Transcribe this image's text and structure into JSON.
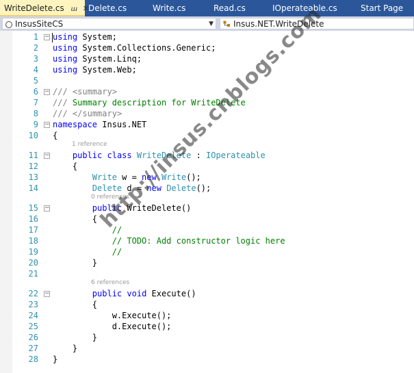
{
  "tabs": [
    {
      "label": "WriteDelete.cs",
      "active": true
    },
    {
      "label": "Delete.cs",
      "active": false
    },
    {
      "label": "Write.cs",
      "active": false
    },
    {
      "label": "Read.cs",
      "active": false
    },
    {
      "label": "IOperateable.cs",
      "active": false
    },
    {
      "label": "Start Page",
      "active": false
    }
  ],
  "nav": {
    "project": "InsusSiteCS",
    "member": "Insus.NET.WriteDelete"
  },
  "code": {
    "line_numbers": [
      "1",
      "2",
      "3",
      "4",
      "5",
      "6",
      "7",
      "8",
      "9",
      "10",
      "11",
      "12",
      "13",
      "14",
      "15",
      "16",
      "17",
      "18",
      "19",
      "20",
      "21",
      "22",
      "23",
      "24",
      "25",
      "26",
      "27",
      "28"
    ],
    "lines": [
      [
        {
          "s": "using",
          "c": "k"
        },
        {
          "s": " System;",
          "c": ""
        }
      ],
      [
        {
          "s": "using",
          "c": "k"
        },
        {
          "s": " System.Collections.Generic;",
          "c": ""
        }
      ],
      [
        {
          "s": "using",
          "c": "k"
        },
        {
          "s": " System.Linq;",
          "c": ""
        }
      ],
      [
        {
          "s": "using",
          "c": "k"
        },
        {
          "s": " System.Web;",
          "c": ""
        }
      ],
      [],
      [
        {
          "s": "///",
          "c": "g"
        },
        {
          "s": " ",
          "c": ""
        },
        {
          "s": "<summary>",
          "c": "g"
        }
      ],
      [
        {
          "s": "///",
          "c": "g"
        },
        {
          "s": " Summary description for WriteDelete",
          "c": "c"
        }
      ],
      [
        {
          "s": "///",
          "c": "g"
        },
        {
          "s": " ",
          "c": ""
        },
        {
          "s": "</summary>",
          "c": "g"
        }
      ],
      [
        {
          "s": "namespace",
          "c": "k"
        },
        {
          "s": " Insus.NET",
          "c": ""
        }
      ],
      [
        {
          "s": "{",
          "c": ""
        }
      ],
      [
        {
          "s": "    ",
          "c": ""
        },
        {
          "s": "public",
          "c": "k"
        },
        {
          "s": " ",
          "c": ""
        },
        {
          "s": "class",
          "c": "k"
        },
        {
          "s": " ",
          "c": ""
        },
        {
          "s": "WriteDelete",
          "c": "t"
        },
        {
          "s": " : ",
          "c": ""
        },
        {
          "s": "IOperateable",
          "c": "t"
        }
      ],
      [
        {
          "s": "    {",
          "c": ""
        }
      ],
      [
        {
          "s": "        ",
          "c": ""
        },
        {
          "s": "Write",
          "c": "t"
        },
        {
          "s": " w = ",
          "c": ""
        },
        {
          "s": "new",
          "c": "k"
        },
        {
          "s": " ",
          "c": ""
        },
        {
          "s": "Write",
          "c": "t"
        },
        {
          "s": "();",
          "c": ""
        }
      ],
      [
        {
          "s": "        ",
          "c": ""
        },
        {
          "s": "Delete",
          "c": "t"
        },
        {
          "s": " d = ",
          "c": ""
        },
        {
          "s": "new",
          "c": "k"
        },
        {
          "s": " ",
          "c": ""
        },
        {
          "s": "Delete",
          "c": "t"
        },
        {
          "s": "();",
          "c": ""
        }
      ],
      [
        {
          "s": "        ",
          "c": ""
        },
        {
          "s": "public",
          "c": "k"
        },
        {
          "s": " WriteDelete()",
          "c": ""
        }
      ],
      [
        {
          "s": "        {",
          "c": ""
        }
      ],
      [
        {
          "s": "            ",
          "c": ""
        },
        {
          "s": "//",
          "c": "c"
        }
      ],
      [
        {
          "s": "            ",
          "c": ""
        },
        {
          "s": "// TODO: Add constructor logic here",
          "c": "c"
        }
      ],
      [
        {
          "s": "            ",
          "c": ""
        },
        {
          "s": "//",
          "c": "c"
        }
      ],
      [
        {
          "s": "        }",
          "c": ""
        }
      ],
      [],
      [
        {
          "s": "        ",
          "c": ""
        },
        {
          "s": "public",
          "c": "k"
        },
        {
          "s": " ",
          "c": ""
        },
        {
          "s": "void",
          "c": "k"
        },
        {
          "s": " Execute()",
          "c": ""
        }
      ],
      [
        {
          "s": "        {",
          "c": ""
        }
      ],
      [
        {
          "s": "            w.Execute();",
          "c": ""
        }
      ],
      [
        {
          "s": "            d.Execute();",
          "c": ""
        }
      ],
      [
        {
          "s": "        }",
          "c": ""
        }
      ],
      [
        {
          "s": "    }",
          "c": ""
        }
      ],
      [
        {
          "s": "}",
          "c": ""
        }
      ]
    ],
    "codelens": {
      "class_refs": "1 reference",
      "ctor_refs": "0 references",
      "method_refs": "6 references"
    }
  },
  "watermark": "http://insus.cnblogs.com",
  "colors": {
    "keyword": "#0000ff",
    "type": "#2b91af",
    "comment": "#008000",
    "doc_tag": "#808080",
    "line_number": "#2b91af",
    "tab_bar": "#2b579a",
    "active_tab": "#fdf4bf"
  }
}
